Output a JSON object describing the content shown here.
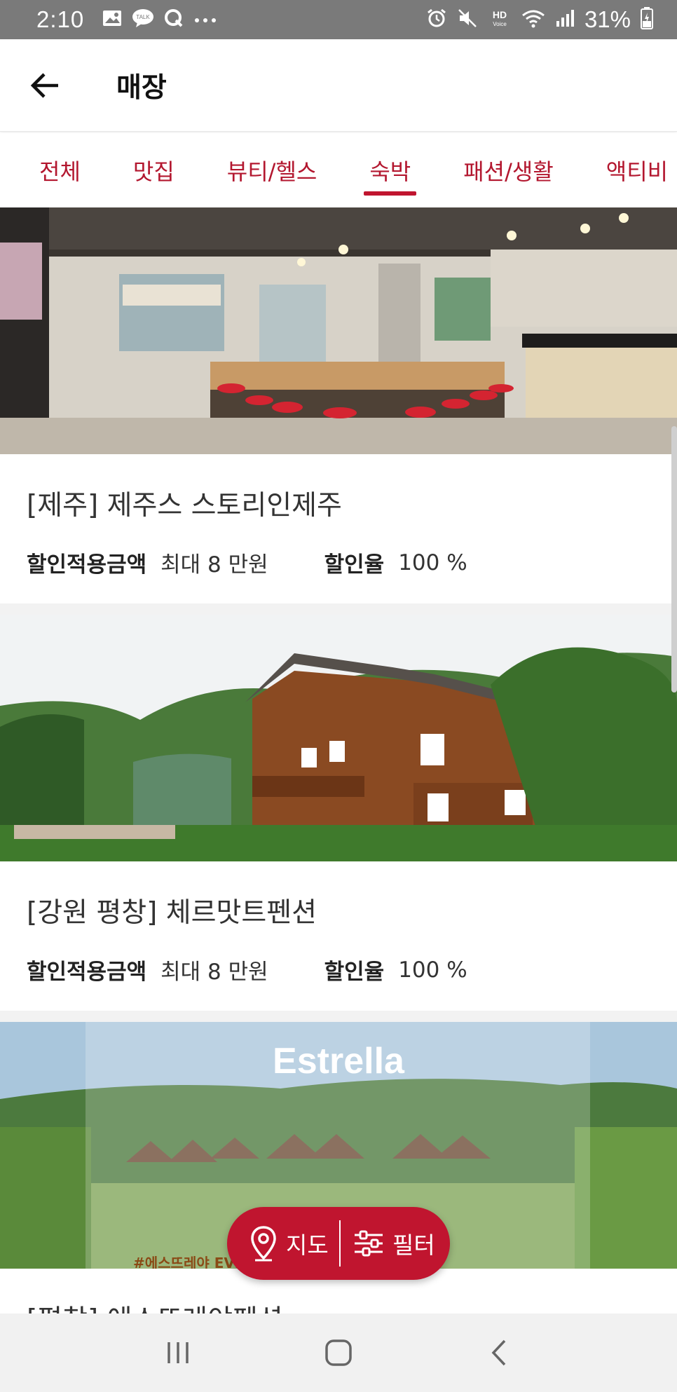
{
  "status_bar": {
    "time": "2:10",
    "battery": "31%",
    "icons_left": [
      "image-icon",
      "talk-icon",
      "q-icon",
      "more-icon"
    ],
    "icons_right": [
      "alarm-icon",
      "mute-icon",
      "hd-voice-icon",
      "wifi-icon",
      "signal-icon",
      "battery-icon"
    ]
  },
  "appbar": {
    "title": "매장"
  },
  "tabs": [
    {
      "label": "전체"
    },
    {
      "label": "맛집"
    },
    {
      "label": "뷰티/헬스"
    },
    {
      "label": "숙박"
    },
    {
      "label": "패션/생활"
    },
    {
      "label": "액티비"
    }
  ],
  "active_tab": "숙박",
  "stores": [
    {
      "title": "[제주] 제주스 스토리인제주",
      "amount_label": "할인적용금액",
      "amount_value": "최대 8 만원",
      "rate_label": "할인율",
      "rate_value": "100 %"
    },
    {
      "title": "[강원 평창] 체르맛트펜션",
      "amount_label": "할인적용금액",
      "amount_value": "최대 8 만원",
      "rate_label": "할인율",
      "rate_value": "100 %"
    },
    {
      "title": "[평창] 에스뜨레야펜션",
      "overlay_title": "Estrella",
      "overlay_caption": "#에스뜨레야 EVENT"
    }
  ],
  "fab": {
    "map_label": "지도",
    "filter_label": "필터"
  },
  "colors": {
    "accent": "#c0152f",
    "status_bar": "#7a7a7a"
  }
}
